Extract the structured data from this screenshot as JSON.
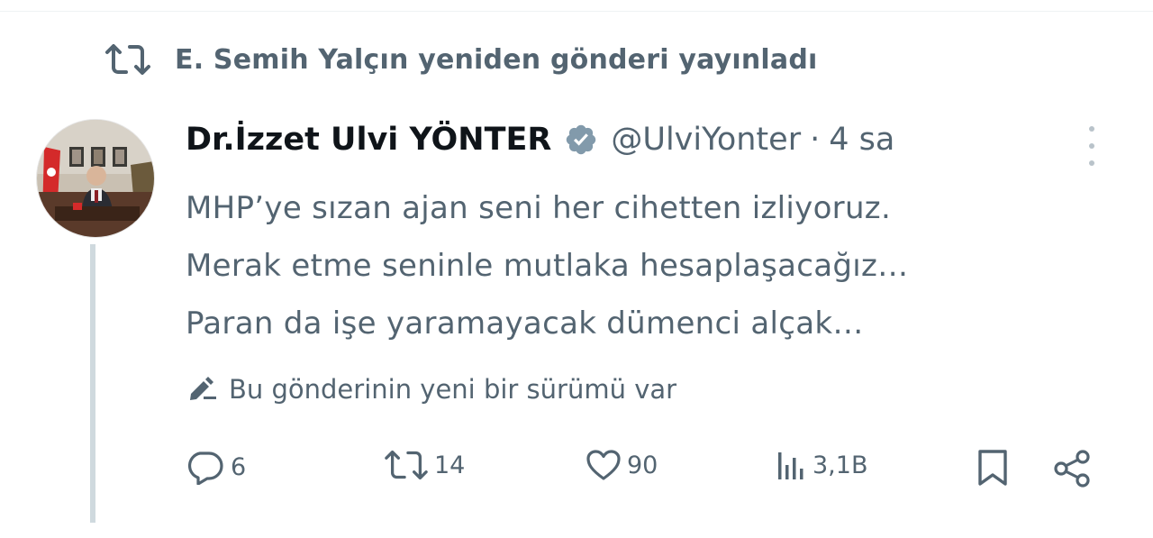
{
  "social_context": {
    "text": "E. Semih Yalçın yeniden gönderi yayınladı"
  },
  "tweet": {
    "display_name": "Dr.İzzet Ulvi YÖNTER",
    "handle": "@UlviYonter",
    "separator": "·",
    "time": "4 sa",
    "verified_badge_color": "#829aab",
    "lines": [
      "MHP’ye sızan ajan seni her cihetten izliyoruz.",
      "Merak etme seninle mutlaka hesaplaşacağız…",
      "Paran da işe yaramayacak dümenci alçak…"
    ],
    "edit_notice": "Bu gönderinin yeni bir sürümü var"
  },
  "actions": {
    "replies": "6",
    "reposts": "14",
    "likes": "90",
    "views": "3,1B"
  },
  "icons": {
    "social_context": "repost-icon",
    "badge": "verified-badge-icon",
    "edit": "pencil-icon",
    "reply": "reply-icon",
    "repost": "repost-icon",
    "like": "heart-icon",
    "views": "views-chart-icon",
    "bookmark": "bookmark-icon",
    "share": "share-icon",
    "more": "more-vertical-icon"
  },
  "colors": {
    "secondary_text": "#536471",
    "primary_text": "#0f1419",
    "thread_line": "#cfd9de"
  }
}
